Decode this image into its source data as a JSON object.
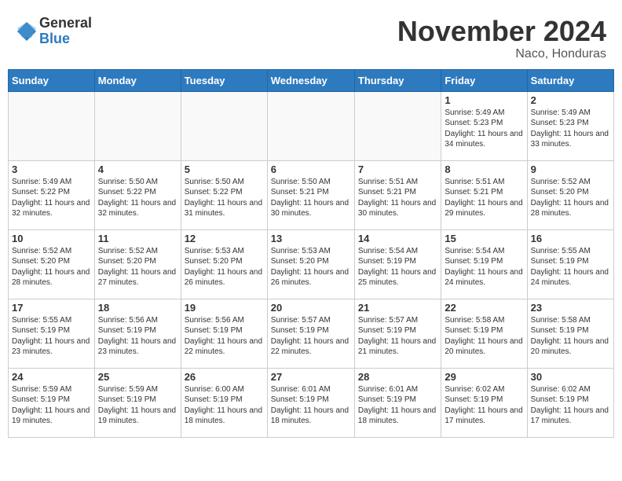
{
  "header": {
    "logo_general": "General",
    "logo_blue": "Blue",
    "month_title": "November 2024",
    "location": "Naco, Honduras"
  },
  "weekdays": [
    "Sunday",
    "Monday",
    "Tuesday",
    "Wednesday",
    "Thursday",
    "Friday",
    "Saturday"
  ],
  "weeks": [
    [
      {
        "day": "",
        "sunrise": "",
        "sunset": "",
        "daylight": ""
      },
      {
        "day": "",
        "sunrise": "",
        "sunset": "",
        "daylight": ""
      },
      {
        "day": "",
        "sunrise": "",
        "sunset": "",
        "daylight": ""
      },
      {
        "day": "",
        "sunrise": "",
        "sunset": "",
        "daylight": ""
      },
      {
        "day": "",
        "sunrise": "",
        "sunset": "",
        "daylight": ""
      },
      {
        "day": "1",
        "sunrise": "Sunrise: 5:49 AM",
        "sunset": "Sunset: 5:23 PM",
        "daylight": "Daylight: 11 hours and 34 minutes."
      },
      {
        "day": "2",
        "sunrise": "Sunrise: 5:49 AM",
        "sunset": "Sunset: 5:23 PM",
        "daylight": "Daylight: 11 hours and 33 minutes."
      }
    ],
    [
      {
        "day": "3",
        "sunrise": "Sunrise: 5:49 AM",
        "sunset": "Sunset: 5:22 PM",
        "daylight": "Daylight: 11 hours and 32 minutes."
      },
      {
        "day": "4",
        "sunrise": "Sunrise: 5:50 AM",
        "sunset": "Sunset: 5:22 PM",
        "daylight": "Daylight: 11 hours and 32 minutes."
      },
      {
        "day": "5",
        "sunrise": "Sunrise: 5:50 AM",
        "sunset": "Sunset: 5:22 PM",
        "daylight": "Daylight: 11 hours and 31 minutes."
      },
      {
        "day": "6",
        "sunrise": "Sunrise: 5:50 AM",
        "sunset": "Sunset: 5:21 PM",
        "daylight": "Daylight: 11 hours and 30 minutes."
      },
      {
        "day": "7",
        "sunrise": "Sunrise: 5:51 AM",
        "sunset": "Sunset: 5:21 PM",
        "daylight": "Daylight: 11 hours and 30 minutes."
      },
      {
        "day": "8",
        "sunrise": "Sunrise: 5:51 AM",
        "sunset": "Sunset: 5:21 PM",
        "daylight": "Daylight: 11 hours and 29 minutes."
      },
      {
        "day": "9",
        "sunrise": "Sunrise: 5:52 AM",
        "sunset": "Sunset: 5:20 PM",
        "daylight": "Daylight: 11 hours and 28 minutes."
      }
    ],
    [
      {
        "day": "10",
        "sunrise": "Sunrise: 5:52 AM",
        "sunset": "Sunset: 5:20 PM",
        "daylight": "Daylight: 11 hours and 28 minutes."
      },
      {
        "day": "11",
        "sunrise": "Sunrise: 5:52 AM",
        "sunset": "Sunset: 5:20 PM",
        "daylight": "Daylight: 11 hours and 27 minutes."
      },
      {
        "day": "12",
        "sunrise": "Sunrise: 5:53 AM",
        "sunset": "Sunset: 5:20 PM",
        "daylight": "Daylight: 11 hours and 26 minutes."
      },
      {
        "day": "13",
        "sunrise": "Sunrise: 5:53 AM",
        "sunset": "Sunset: 5:20 PM",
        "daylight": "Daylight: 11 hours and 26 minutes."
      },
      {
        "day": "14",
        "sunrise": "Sunrise: 5:54 AM",
        "sunset": "Sunset: 5:19 PM",
        "daylight": "Daylight: 11 hours and 25 minutes."
      },
      {
        "day": "15",
        "sunrise": "Sunrise: 5:54 AM",
        "sunset": "Sunset: 5:19 PM",
        "daylight": "Daylight: 11 hours and 24 minutes."
      },
      {
        "day": "16",
        "sunrise": "Sunrise: 5:55 AM",
        "sunset": "Sunset: 5:19 PM",
        "daylight": "Daylight: 11 hours and 24 minutes."
      }
    ],
    [
      {
        "day": "17",
        "sunrise": "Sunrise: 5:55 AM",
        "sunset": "Sunset: 5:19 PM",
        "daylight": "Daylight: 11 hours and 23 minutes."
      },
      {
        "day": "18",
        "sunrise": "Sunrise: 5:56 AM",
        "sunset": "Sunset: 5:19 PM",
        "daylight": "Daylight: 11 hours and 23 minutes."
      },
      {
        "day": "19",
        "sunrise": "Sunrise: 5:56 AM",
        "sunset": "Sunset: 5:19 PM",
        "daylight": "Daylight: 11 hours and 22 minutes."
      },
      {
        "day": "20",
        "sunrise": "Sunrise: 5:57 AM",
        "sunset": "Sunset: 5:19 PM",
        "daylight": "Daylight: 11 hours and 22 minutes."
      },
      {
        "day": "21",
        "sunrise": "Sunrise: 5:57 AM",
        "sunset": "Sunset: 5:19 PM",
        "daylight": "Daylight: 11 hours and 21 minutes."
      },
      {
        "day": "22",
        "sunrise": "Sunrise: 5:58 AM",
        "sunset": "Sunset: 5:19 PM",
        "daylight": "Daylight: 11 hours and 20 minutes."
      },
      {
        "day": "23",
        "sunrise": "Sunrise: 5:58 AM",
        "sunset": "Sunset: 5:19 PM",
        "daylight": "Daylight: 11 hours and 20 minutes."
      }
    ],
    [
      {
        "day": "24",
        "sunrise": "Sunrise: 5:59 AM",
        "sunset": "Sunset: 5:19 PM",
        "daylight": "Daylight: 11 hours and 19 minutes."
      },
      {
        "day": "25",
        "sunrise": "Sunrise: 5:59 AM",
        "sunset": "Sunset: 5:19 PM",
        "daylight": "Daylight: 11 hours and 19 minutes."
      },
      {
        "day": "26",
        "sunrise": "Sunrise: 6:00 AM",
        "sunset": "Sunset: 5:19 PM",
        "daylight": "Daylight: 11 hours and 18 minutes."
      },
      {
        "day": "27",
        "sunrise": "Sunrise: 6:01 AM",
        "sunset": "Sunset: 5:19 PM",
        "daylight": "Daylight: 11 hours and 18 minutes."
      },
      {
        "day": "28",
        "sunrise": "Sunrise: 6:01 AM",
        "sunset": "Sunset: 5:19 PM",
        "daylight": "Daylight: 11 hours and 18 minutes."
      },
      {
        "day": "29",
        "sunrise": "Sunrise: 6:02 AM",
        "sunset": "Sunset: 5:19 PM",
        "daylight": "Daylight: 11 hours and 17 minutes."
      },
      {
        "day": "30",
        "sunrise": "Sunrise: 6:02 AM",
        "sunset": "Sunset: 5:19 PM",
        "daylight": "Daylight: 11 hours and 17 minutes."
      }
    ]
  ]
}
